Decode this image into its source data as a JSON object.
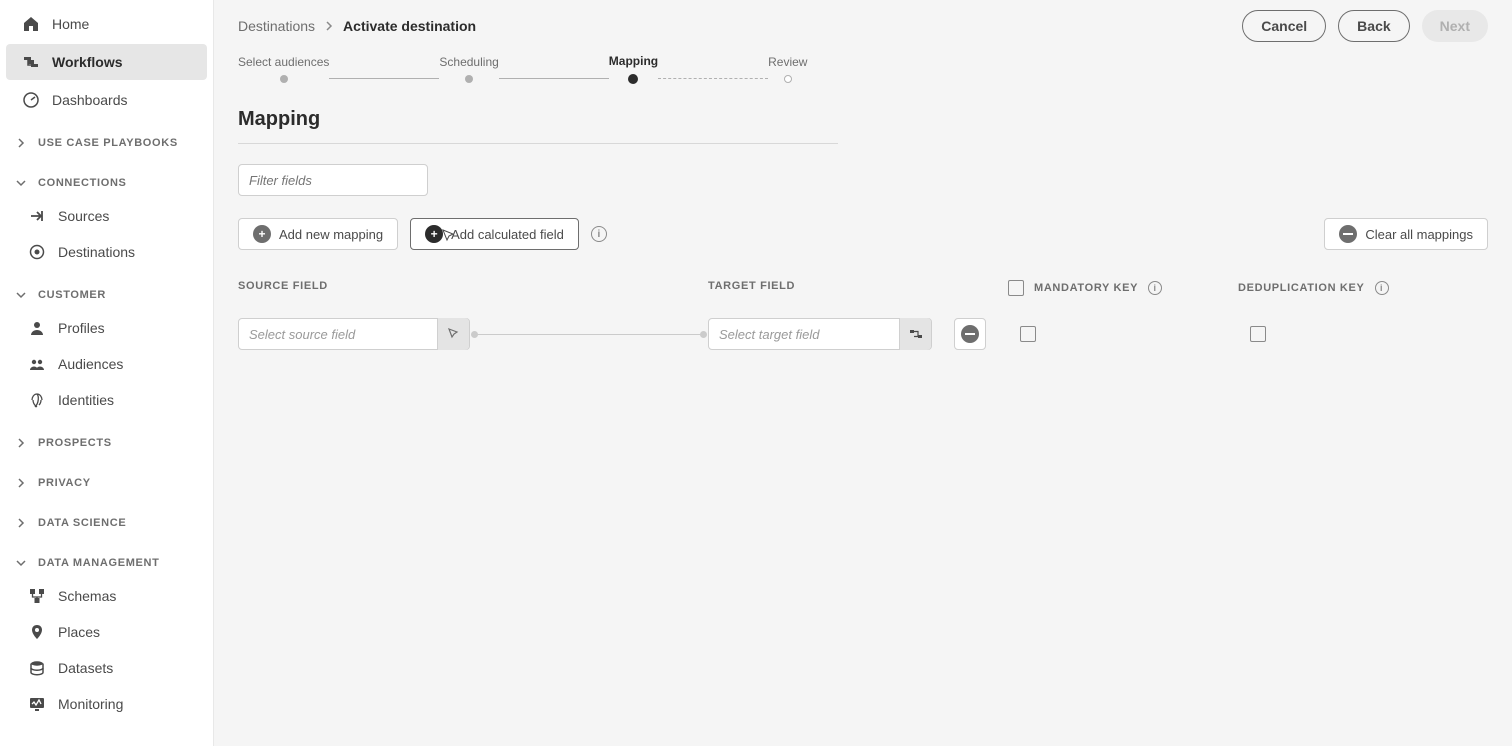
{
  "sidebar": {
    "items_top": [
      {
        "label": "Home",
        "icon": "home"
      },
      {
        "label": "Workflows",
        "icon": "workflows",
        "selected": true
      },
      {
        "label": "Dashboards",
        "icon": "dashboards"
      }
    ],
    "sections": [
      {
        "label": "USE CASE PLAYBOOKS",
        "expanded": false,
        "items": []
      },
      {
        "label": "CONNECTIONS",
        "expanded": true,
        "items": [
          {
            "label": "Sources",
            "icon": "sources"
          },
          {
            "label": "Destinations",
            "icon": "destinations"
          }
        ]
      },
      {
        "label": "CUSTOMER",
        "expanded": true,
        "items": [
          {
            "label": "Profiles",
            "icon": "profiles"
          },
          {
            "label": "Audiences",
            "icon": "audiences"
          },
          {
            "label": "Identities",
            "icon": "identities"
          }
        ]
      },
      {
        "label": "PROSPECTS",
        "expanded": false,
        "items": []
      },
      {
        "label": "PRIVACY",
        "expanded": false,
        "items": []
      },
      {
        "label": "DATA SCIENCE",
        "expanded": false,
        "items": []
      },
      {
        "label": "DATA MANAGEMENT",
        "expanded": true,
        "items": [
          {
            "label": "Schemas",
            "icon": "schemas"
          },
          {
            "label": "Places",
            "icon": "places"
          },
          {
            "label": "Datasets",
            "icon": "datasets"
          },
          {
            "label": "Monitoring",
            "icon": "monitoring"
          }
        ]
      }
    ]
  },
  "breadcrumb": {
    "root": "Destinations",
    "current": "Activate destination"
  },
  "actions": {
    "cancel": "Cancel",
    "back": "Back",
    "next": "Next"
  },
  "steps": [
    "Select audiences",
    "Scheduling",
    "Mapping",
    "Review"
  ],
  "activeStep": 2,
  "page": {
    "title": "Mapping"
  },
  "filter": {
    "placeholder": "Filter fields"
  },
  "toolbar": {
    "add_new": "Add new mapping",
    "add_calc": "Add calculated field",
    "clear": "Clear all mappings"
  },
  "columns": {
    "source": "SOURCE FIELD",
    "target": "TARGET FIELD",
    "mandatory": "MANDATORY KEY",
    "dedup": "DEDUPLICATION KEY"
  },
  "row": {
    "source_ph": "Select source field",
    "target_ph": "Select target field"
  }
}
